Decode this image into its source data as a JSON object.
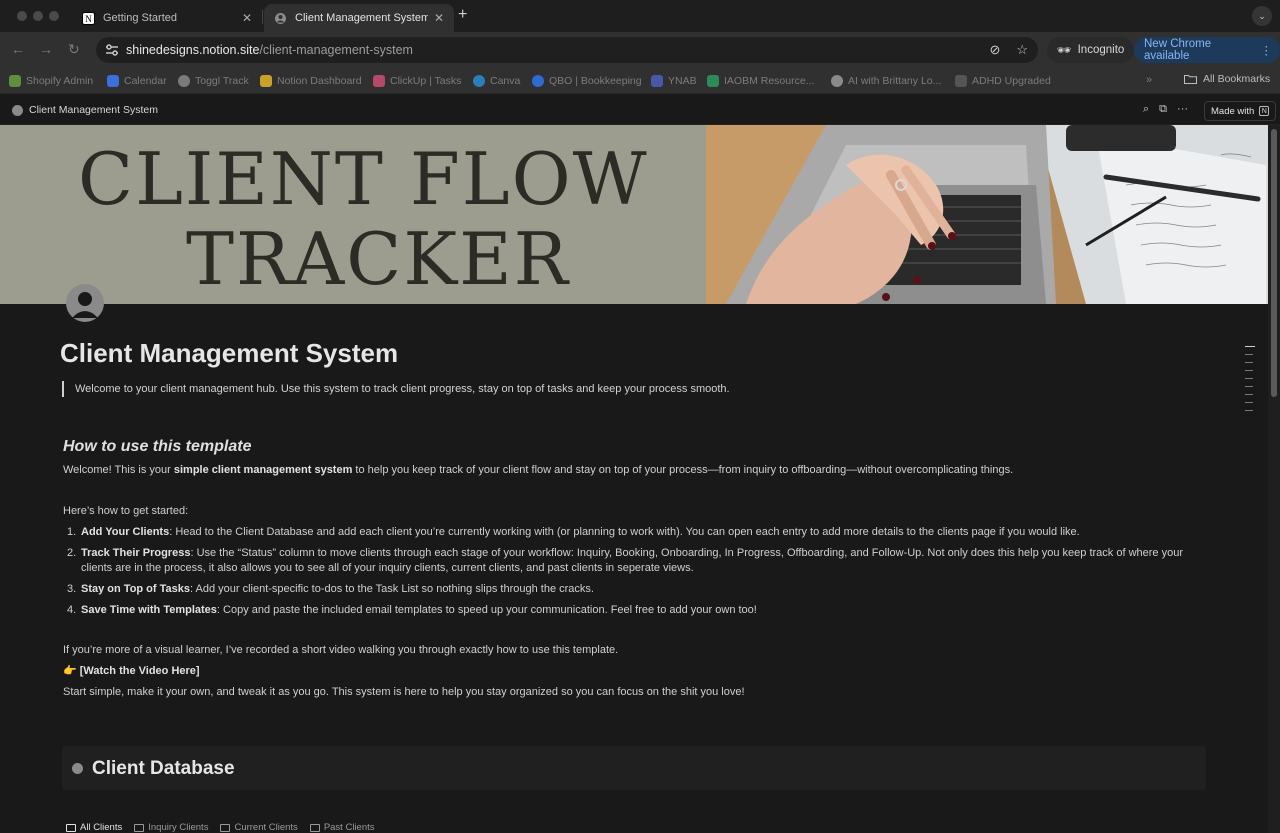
{
  "browser": {
    "tabs": [
      {
        "title": "Getting Started",
        "favicon": "notion-icon",
        "active": false
      },
      {
        "title": "Client Management System",
        "favicon": "globe-icon",
        "active": true
      }
    ],
    "url_host": "shinedesigns.notion.site",
    "url_path": "/client-management-system",
    "incognito_label": "Incognito",
    "update_label": "New Chrome available",
    "bookmarks": [
      {
        "label": "Shopify Admin",
        "icon_color": "#5e8e3e"
      },
      {
        "label": "Calendar",
        "icon_color": "#3b6fd9"
      },
      {
        "label": "Toggl Track",
        "icon_color": "#7a7a7a"
      },
      {
        "label": "Notion Dashboard",
        "icon_color": "#c9a227"
      },
      {
        "label": "ClickUp | Tasks",
        "icon_color": "#b34a6a"
      },
      {
        "label": "Canva",
        "icon_color": "#2a7fb8"
      },
      {
        "label": "QBO | Bookkeeping",
        "icon_color": "#2f6cd1"
      },
      {
        "label": "YNAB",
        "icon_color": "#4a56a8"
      },
      {
        "label": "IAOBM Resource...",
        "icon_color": "#2f8a5a"
      },
      {
        "label": "AI with Brittany Lo...",
        "icon_color": "#8a8a8a"
      },
      {
        "label": "ADHD Upgraded",
        "icon_color": "#555555"
      }
    ],
    "all_bookmarks_label": "All Bookmarks"
  },
  "notion": {
    "breadcrumb": "Client Management System",
    "made_with": "Made with"
  },
  "cover": {
    "line1": "CLIENT FLOW",
    "line2": "TRACKER"
  },
  "page": {
    "title": "Client Management System",
    "callout": "Welcome to your client management hub. Use this system to track client progress, stay on top of tasks and keep your process smooth.",
    "howto_heading": "How to use this template",
    "intro_pre": "Welcome! This is your ",
    "intro_bold": "simple client management system",
    "intro_post": " to help you keep track of your client flow and stay on top of your process—from inquiry to offboarding—without overcomplicating things.",
    "get_started": "Here’s how to get started:",
    "steps": [
      {
        "num": "1.",
        "bold": "Add Your Clients",
        "text": ": Head to the Client Database and add each client you’re currently working with (or planning to work with). You can open each entry to add more details to the clients page if you would like."
      },
      {
        "num": "2.",
        "bold": "Track Their Progress",
        "text": ": Use the “Status” column to move clients through each stage of your workflow: Inquiry, Booking, Onboarding, In Progress, Offboarding, and Follow-Up. Not only does this help you keep track of where your clients are in the process, it also allows you to see all of your inquiry clients, current clients, and past clients in seperate views."
      },
      {
        "num": "3.",
        "bold": "Stay on Top of Tasks",
        "text": ": Add your client-specific to-dos to the Task List so nothing slips through the cracks."
      },
      {
        "num": "4.",
        "bold": "Save Time with Templates",
        "text": ": Copy and paste the included email templates to speed up your communication. Feel free to add your own too!"
      }
    ],
    "video_intro": "If you’re more of a visual learner, I’ve recorded a short video walking you through exactly how to use this template.",
    "video_emoji": "👉",
    "video_link": "[Watch the Video Here]",
    "closing": "Start simple, make it your own, and tweak it as you go. This system is here to help you stay organized so you can focus on the shit you love!"
  },
  "database": {
    "title": "Client Database",
    "views": [
      "All Clients",
      "Inquiry Clients",
      "Current Clients",
      "Past Clients"
    ]
  }
}
